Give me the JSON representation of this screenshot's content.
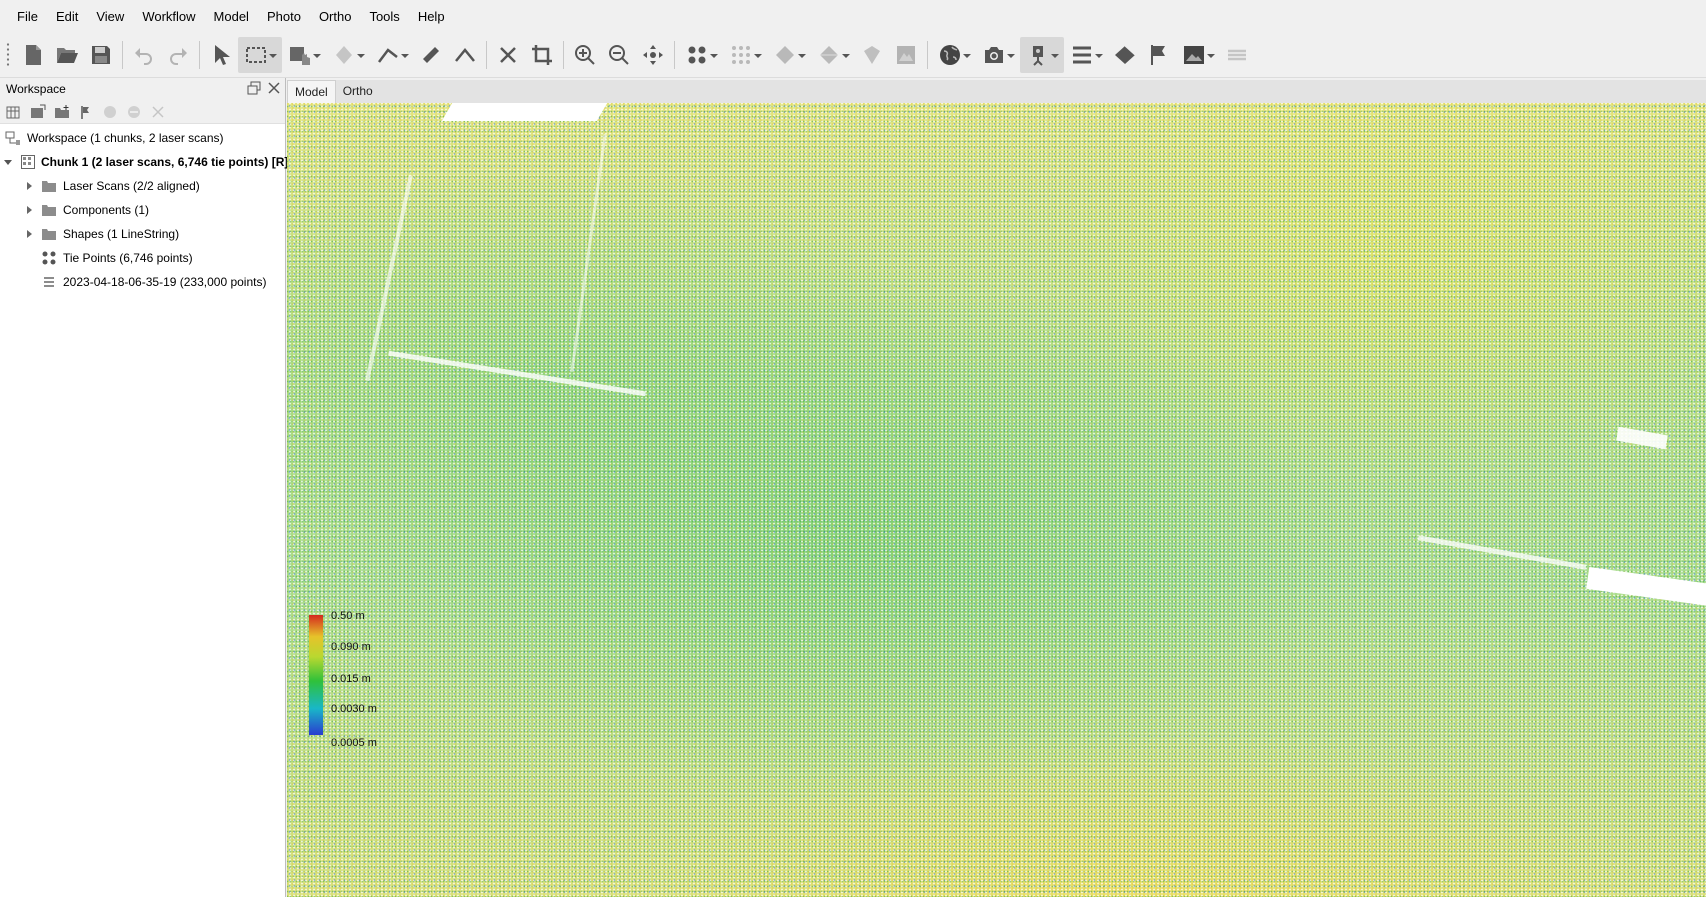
{
  "menu": [
    "File",
    "Edit",
    "View",
    "Workflow",
    "Model",
    "Photo",
    "Ortho",
    "Tools",
    "Help"
  ],
  "workspace": {
    "title": "Workspace",
    "tree": [
      {
        "label": "Workspace (1 chunks, 2 laser scans)",
        "icon": "workspace-icon"
      },
      {
        "label": "Chunk 1 (2 laser scans, 6,746 tie points) [R]",
        "icon": "chunk-icon"
      },
      {
        "label": "Laser Scans (2/2 aligned)",
        "icon": "folder-icon"
      },
      {
        "label": "Components (1)",
        "icon": "folder-icon"
      },
      {
        "label": "Shapes (1 LineString)",
        "icon": "folder-icon"
      },
      {
        "label": "Tie Points (6,746 points)",
        "icon": "tie-points-icon"
      },
      {
        "label": "2023-04-18-06-35-19 (233,000 points)",
        "icon": "point-cloud-icon"
      }
    ]
  },
  "tabs": [
    "Model",
    "Ortho"
  ],
  "legend": {
    "labels": [
      "0.50 m",
      "0.090 m",
      "0.015 m",
      "0.0030 m",
      "0.0005 m"
    ],
    "colors": [
      "#d42a1e",
      "#e6c32a",
      "#2fc13a",
      "#19b7c8",
      "#2a3ccf"
    ]
  }
}
